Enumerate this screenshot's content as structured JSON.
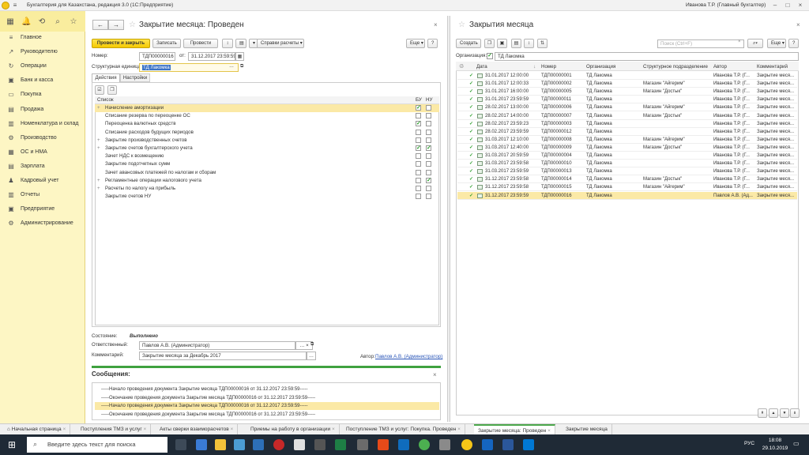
{
  "app": {
    "title": "Бухгалтерия для Казахстана, редакция 3.0  (1С:Предприятие)",
    "user": "Иванова Т.Р. (Главный бухгалтер)"
  },
  "nav": [
    "Главное",
    "Руководителю",
    "Операции",
    "Банк и касса",
    "Покупка",
    "Продажа",
    "Номенклатура и склад",
    "Производство",
    "ОС и НМА",
    "Зарплата",
    "Кадровый учет",
    "Отчеты",
    "Предприятие",
    "Администрирование"
  ],
  "doc": {
    "title": "Закрытие месяца: Проведен",
    "btn_post_close": "Провести и закрыть",
    "btn_save": "Записать",
    "btn_post": "Провести",
    "btn_calc": "Справки расчеты",
    "btn_more": "Еще",
    "btn_help": "?",
    "number_label": "Номер:",
    "number": "ТДП00000016",
    "date_label": "от:",
    "date": "31.12.2017 23:59:59",
    "unit_label": "Структурная единица:",
    "unit": "ТД Лакомка",
    "tabs": [
      "Действия",
      "Настройки"
    ],
    "list_header": "Список",
    "col_bu": "БУ",
    "col_nu": "НУ",
    "rows": [
      {
        "name": "Начисление амортизации",
        "exp": "+",
        "bu": "✓",
        "nu": "",
        "hl": true
      },
      {
        "name": "Списание резерва по переоценке ОС",
        "exp": "",
        "bu": "",
        "nu": ""
      },
      {
        "name": "Переоценка валютных средств",
        "exp": "",
        "bu": "✓",
        "nu": ""
      },
      {
        "name": "Списание расходов будущих периодов",
        "exp": "",
        "bu": "",
        "nu": ""
      },
      {
        "name": "Закрытие производственных счетов",
        "exp": "+",
        "bu": "",
        "nu": ""
      },
      {
        "name": "Закрытие счетов бухгалтерского учета",
        "exp": "+",
        "bu": "✓",
        "nu": "✓"
      },
      {
        "name": "Зачет НДС к возмещению",
        "exp": "",
        "bu": "",
        "nu": ""
      },
      {
        "name": "Закрытие подотчетных сумм",
        "exp": "",
        "bu": "",
        "nu": ""
      },
      {
        "name": "Зачет авансовых платежей по налогам и сборам",
        "exp": "",
        "bu": "",
        "nu": ""
      },
      {
        "name": "Регламентные операции налогового учета",
        "exp": "+",
        "bu": "",
        "nu": "✓"
      },
      {
        "name": "Расчеты по налогу на прибыль",
        "exp": "+",
        "bu": "",
        "nu": ""
      },
      {
        "name": "Закрытие счетов НУ",
        "exp": "",
        "bu": "",
        "nu": ""
      }
    ],
    "state_label": "Состояние:",
    "state": "Выполнено",
    "resp_label": "Ответственный:",
    "resp": "Павлов А.В. (Администратор)",
    "comment_label": "Комментарий:",
    "comment": "Закрытие месяца за Декабрь 2017",
    "author_label": "Автор:",
    "author": "Павлов А.В. (Администратор)"
  },
  "messages": {
    "title": "Сообщения:",
    "items": [
      {
        "text": "-----Начало проведения документа Закрытие месяца ТДП00000016 от 31.12.2017 23:59:59-----",
        "hl": false
      },
      {
        "text": "-----Окончание проведения документа Закрытие месяца ТДП00000016 от 31.12.2017 23:59:59-----",
        "hl": false
      },
      {
        "text": "-----Начало проведения документа Закрытие месяца ТДП00000016 от 31.12.2017 23:59:59-----",
        "hl": true
      },
      {
        "text": "-----Окончание проведения документа Закрытие месяца ТДП00000016 от 31.12.2017 23:59:59-----",
        "hl": false
      }
    ]
  },
  "list": {
    "title": "Закрытия месяца",
    "btn_create": "Создать",
    "search_placeholder": "Поиск (Ctrl+F)",
    "btn_more": "Еще",
    "btn_help": "?",
    "org_label": "Организация:",
    "org": "ТД Лакомка",
    "cols": [
      "Дата",
      "Номер",
      "Организация",
      "Структурное подразделение",
      "Автор",
      "Комментарий"
    ],
    "rows": [
      {
        "date": "31.01.2017 12:00:00",
        "num": "ТДП00000001",
        "org": "ТД Лакомка",
        "div": "",
        "author": "Иванова Т.Р. (Г...",
        "comm": "Закрытие меся..."
      },
      {
        "date": "31.01.2017 12:00:33",
        "num": "ТДП00000002",
        "org": "ТД Лакомка",
        "div": "Магазин \"Айгерим\"",
        "author": "Иванова Т.Р. (Г...",
        "comm": "Закрытие меся..."
      },
      {
        "date": "31.01.2017 16:00:00",
        "num": "ТДП00000005",
        "org": "ТД Лакомка",
        "div": "Магазин \"Достык\"",
        "author": "Иванова Т.Р. (Г...",
        "comm": "Закрытие меся..."
      },
      {
        "date": "31.01.2017 23:59:59",
        "num": "ТДП00000011",
        "org": "ТД Лакомка",
        "div": "",
        "author": "Иванова Т.Р. (Г...",
        "comm": "Закрытие меся..."
      },
      {
        "date": "28.02.2017 13:00:00",
        "num": "ТДП00000006",
        "org": "ТД Лакомка",
        "div": "Магазин \"Айгерим\"",
        "author": "Иванова Т.Р. (Г...",
        "comm": "Закрытие меся..."
      },
      {
        "date": "28.02.2017 14:00:00",
        "num": "ТДП00000007",
        "org": "ТД Лакомка",
        "div": "Магазин \"Достык\"",
        "author": "Иванова Т.Р. (Г...",
        "comm": "Закрытие меся..."
      },
      {
        "date": "28.02.2017 23:59:23",
        "num": "ТДП00000003",
        "org": "ТД Лакомка",
        "div": "",
        "author": "Иванова Т.Р. (Г...",
        "comm": "Закрытие меся..."
      },
      {
        "date": "28.02.2017 23:59:59",
        "num": "ТДП00000012",
        "org": "ТД Лакомка",
        "div": "",
        "author": "Иванова Т.Р. (Г...",
        "comm": "Закрытие меся..."
      },
      {
        "date": "31.03.2017 12:10:00",
        "num": "ТДП00000008",
        "org": "ТД Лакомка",
        "div": "Магазин \"Айгерим\"",
        "author": "Иванова Т.Р. (Г...",
        "comm": "Закрытие меся..."
      },
      {
        "date": "31.03.2017 12:40:00",
        "num": "ТДП00000009",
        "org": "ТД Лакомка",
        "div": "Магазин \"Достык\"",
        "author": "Иванова Т.Р. (Г...",
        "comm": "Закрытие меся..."
      },
      {
        "date": "31.03.2017 20:59:59",
        "num": "ТДП00000004",
        "org": "ТД Лакомка",
        "div": "",
        "author": "Иванова Т.Р. (Г...",
        "comm": "Закрытие меся..."
      },
      {
        "date": "31.03.2017 23:59:58",
        "num": "ТДП00000010",
        "org": "ТД Лакомка",
        "div": "",
        "author": "Иванова Т.Р. (Г...",
        "comm": "Закрытие меся..."
      },
      {
        "date": "31.03.2017 23:59:59",
        "num": "ТДП00000013",
        "org": "ТД Лакомка",
        "div": "",
        "author": "Иванова Т.Р. (Г...",
        "comm": "Закрытие меся..."
      },
      {
        "date": "31.12.2017 23:59:58",
        "num": "ТДП00000014",
        "org": "ТД Лакомка",
        "div": "Магазин \"Достык\"",
        "author": "Иванова Т.Р. (Г...",
        "comm": "Закрытие меся..."
      },
      {
        "date": "31.12.2017 23:59:58",
        "num": "ТДП00000015",
        "org": "ТД Лакомка",
        "div": "Магазин \"Айгерим\"",
        "author": "Иванова Т.Р. (Г...",
        "comm": "Закрытие меся..."
      },
      {
        "date": "31.12.2017 23:59:59",
        "num": "ТДП00000016",
        "org": "ТД Лакомка",
        "div": "",
        "author": "Павлов А.В. (Ад...",
        "comm": "Закрытие меся..."
      }
    ]
  },
  "tabs": [
    "Начальная страница",
    "Поступления ТМЗ и услуг",
    "Акты сверки взаиморасчетов",
    "Приемы на работу в организации",
    "Поступление ТМЗ и услуг: Покупка. Проведен",
    "Закрытие месяца: Проведен",
    "Закрытие месяца"
  ],
  "taskbar": {
    "search": "Введите здесь текст для поиска",
    "lang": "РУС",
    "time": "18:08",
    "date": "29.10.2019"
  },
  "colors": {
    "accent_yellow": "#f5c900",
    "highlight_row": "#fbe9a6",
    "check_green": "#2a9d2a",
    "nav_bg": "#fdf6c4"
  }
}
